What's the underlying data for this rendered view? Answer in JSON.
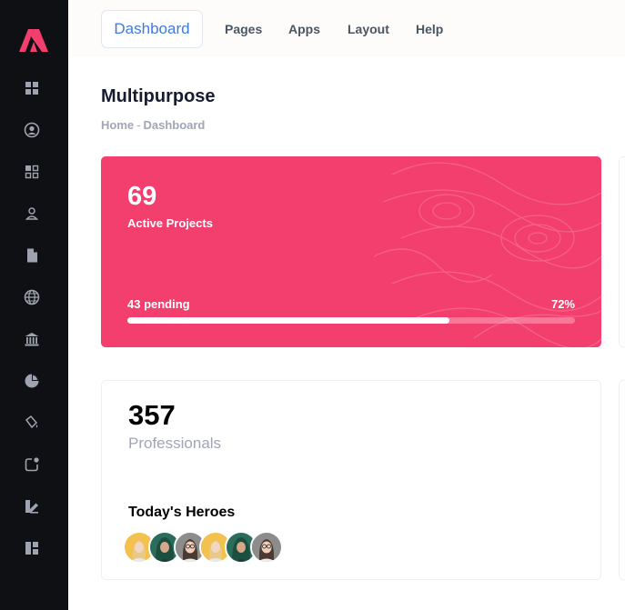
{
  "sidebar": {
    "logo": "brand-logo",
    "icons": [
      "grid-icon",
      "user-circle-icon",
      "apps-icon",
      "user-icon",
      "document-icon",
      "globe-icon",
      "bank-icon",
      "pie-chart-icon",
      "paint-bucket-icon",
      "notification-icon",
      "edit-icon",
      "layout-icon"
    ]
  },
  "topnav": {
    "items": [
      "Dashboard",
      "Pages",
      "Apps",
      "Layout",
      "Help"
    ],
    "active": "Dashboard"
  },
  "page": {
    "title": "Multipurpose",
    "breadcrumb": [
      "Home",
      "Dashboard"
    ]
  },
  "projects_card": {
    "count": "69",
    "label": "Active Projects",
    "pending": "43 pending",
    "percent": "72%",
    "progress": 0.72,
    "color": "#f33f6e"
  },
  "professionals_card": {
    "count": "357",
    "label": "Professionals",
    "heroes_title": "Today's Heroes",
    "avatars": [
      "blonde-woman-avatar",
      "hooded-man-avatar",
      "glasses-woman-avatar",
      "blonde-woman-avatar",
      "hooded-man-avatar",
      "glasses-woman-avatar"
    ]
  },
  "colors": {
    "accent": "#3e7be0",
    "sidebar_bg": "#0f1014",
    "muted": "#a1a5b7"
  }
}
